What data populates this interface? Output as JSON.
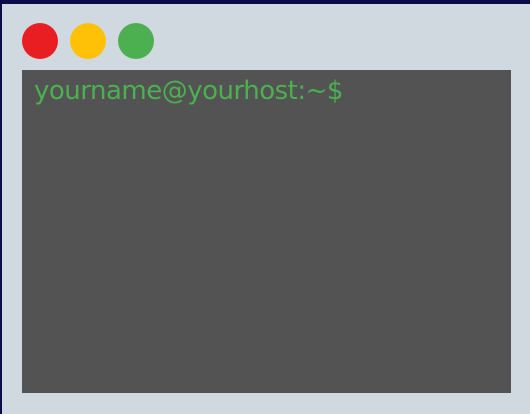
{
  "window": {
    "controls": [
      {
        "name": "close",
        "color": "#e91e22"
      },
      {
        "name": "minimize",
        "color": "#ffc107"
      },
      {
        "name": "maximize",
        "color": "#4caf50"
      }
    ]
  },
  "terminal": {
    "prompt": "yourname@yourhost:~$",
    "prompt_color": "#4caf50",
    "background": "#535353"
  }
}
